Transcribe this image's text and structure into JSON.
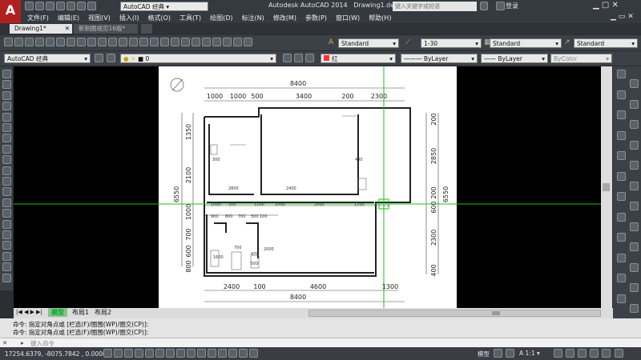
{
  "app_logo": "A",
  "title_bar": {
    "workspace": "AutoCAD 经典",
    "title": "Autodesk AutoCAD 2014",
    "file": "Drawing1.dwg",
    "search_placeholder": "键入关键字或短语",
    "login": "登录"
  },
  "menu": [
    "文件(F)",
    "编辑(E)",
    "视图(V)",
    "插入(I)",
    "格式(O)",
    "工具(T)",
    "绘图(D)",
    "标注(N)",
    "修改(M)",
    "参数(P)",
    "窗口(W)",
    "帮助(H)"
  ],
  "doc_tabs": [
    "Drawing1*",
    "新制图规范16版*"
  ],
  "styles_toolbar": {
    "text_style": "Standard",
    "dim_style": "1-30",
    "table_style": "Standard",
    "mleader_style": "Standard"
  },
  "layers_toolbar": {
    "workspace": "AutoCAD 经典",
    "layer": "0",
    "color": "红",
    "linetype": "ByLayer",
    "lineweight": "ByLayer",
    "plotstyle": "ByColor"
  },
  "colors": {
    "accent": "#ff3030",
    "crosshair": "#18c018",
    "canvas": "#000000",
    "paper": "#ffffff"
  },
  "drawing": {
    "top_total": "8400",
    "top_dims": [
      "1000",
      "1000",
      "500",
      "3400",
      "200",
      "2300"
    ],
    "left_total": "6550",
    "left_dims_upper": [
      "1350",
      "2100"
    ],
    "left_dims_lower": [
      "1000",
      "700",
      "600",
      "800"
    ],
    "right_total": "6550",
    "right_dims_upper": [
      "200",
      "2850",
      "200"
    ],
    "right_dims_lower": [
      "600",
      "2300",
      "400"
    ],
    "middle_dims": [
      "1000",
      "500",
      "1100",
      "1000",
      "2000",
      "1200"
    ],
    "inner_dims": [
      "900",
      "600",
      "700",
      "500",
      "100"
    ],
    "small_dims": [
      "2800",
      "2400",
      "300",
      "400",
      "1600",
      "470",
      "700",
      "2000",
      "500"
    ],
    "bottom_dims": [
      "2400",
      "100",
      "4600",
      "1300"
    ],
    "bottom_total": "8400"
  },
  "layout_tabs": [
    "模型",
    "布局1",
    "布局2"
  ],
  "command_lines": [
    "命令: 指定对角点或 [栏选(F)/圈围(WP)/圈交(CP)]:",
    "命令: 指定对角点或 [栏选(F)/圈围(WP)/圈交(CP)]:"
  ],
  "command_placeholder": "键入命令",
  "status": {
    "coords": "17254.6379, -8075.7842 , 0.0000",
    "model": "模型",
    "scale": "1:1"
  }
}
